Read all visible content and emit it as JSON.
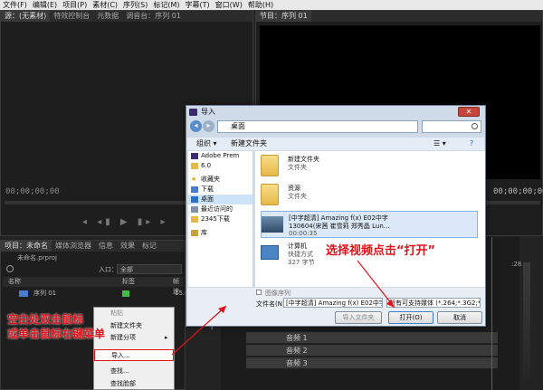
{
  "menu": [
    "文件(F)",
    "编辑(E)",
    "项目(P)",
    "素材(C)",
    "序列(S)",
    "标记(M)",
    "字幕(T)",
    "窗口(W)",
    "帮助(H)"
  ],
  "source_tabs": [
    "源：(无素材)",
    "特效控制台",
    "元数据",
    "调音台：序列 01"
  ],
  "program_tab": "节目：序列 01",
  "timecode": "00;00;00;00",
  "project": {
    "tabs": [
      "项目：未命名",
      "媒体浏览器",
      "信息",
      "效果",
      "标记"
    ],
    "file": "未命名.prproj",
    "entry_label": "入口：",
    "entry_value": "全部",
    "col_name": "名称",
    "col_label": "标签",
    "col_rate": "帧速",
    "item": "序列 01",
    "item_rate": "15.0"
  },
  "timeline": {
    "timecode_right": "00;00;00;00",
    "tracks": [
      "音频 1",
      "音频 2",
      "音频 3"
    ],
    "tick": ":28"
  },
  "dialog": {
    "title": "导入",
    "address": "桌面",
    "organize": "组织 ▾",
    "new_folder": "新建文件夹",
    "sidebar": [
      "Adobe Prem",
      "6.0",
      "收藏夹",
      "下载",
      "桌面",
      "最近访问的",
      "2345下载",
      "库"
    ],
    "files": [
      {
        "name": "新建文件夹",
        "type": "文件夹"
      },
      {
        "name": "资源",
        "type": "文件夹"
      },
      {
        "name": "[中字超清] Amazing f(x) E02中字",
        "name2": "130604(宋茜 崔雪莉 郑秀晶 Lun...",
        "duration": "00:00:35"
      },
      {
        "name": "计算机",
        "type": "快捷方式",
        "size": "327 字节"
      }
    ],
    "image_seq": "图像序列",
    "filename_label": "文件名(N):",
    "filename_value": "[中字超清] Amazing f(x) E02中字",
    "filetype": "所有可支持媒体 (*.264;*.3G2;*",
    "btn_import_folder": "导入文件夹",
    "btn_open": "打开(O)",
    "btn_cancel": "取消",
    "close": "✕"
  },
  "context_menu": [
    "粘贴",
    "新建文件夹",
    "新建分项",
    "导入...",
    "查找...",
    "查找脸部"
  ],
  "annotations": {
    "left_line1": "空白处双击鼠标",
    "left_line2": "或单击鼠标右键菜单",
    "right": "选择视频点击“打开”"
  },
  "colors": {
    "annotation": "#e0121a",
    "accent": "#3c7fd0",
    "label_green": "#3fbf3f"
  }
}
